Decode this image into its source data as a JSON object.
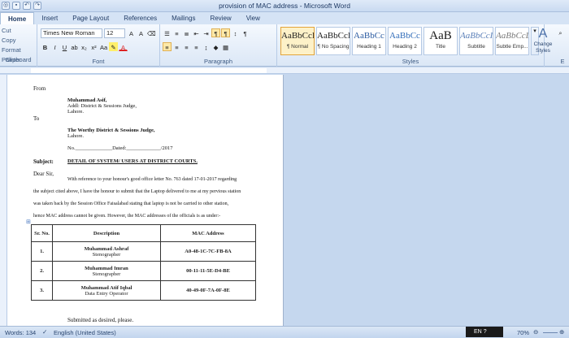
{
  "window": {
    "title": "provision of MAC address - Microsoft Word"
  },
  "tabs": [
    "Home",
    "Insert",
    "Page Layout",
    "References",
    "Mailings",
    "Review",
    "View"
  ],
  "ribbon": {
    "clipboard": {
      "cut": "Cut",
      "copy": "Copy",
      "format_painter": "Format Painter",
      "label": "Clipboard"
    },
    "font": {
      "name": "Times New Roman",
      "size": "12",
      "label": "Font"
    },
    "paragraph": {
      "label": "Paragraph"
    },
    "styles": {
      "label": "Styles",
      "change_styles": "Change Styles",
      "items": [
        {
          "sample": "AaBbCcI",
          "name": "¶ Normal"
        },
        {
          "sample": "AaBbCcI",
          "name": "¶ No Spacing"
        },
        {
          "sample": "AaBbCc",
          "name": "Heading 1"
        },
        {
          "sample": "AaBbCc",
          "name": "Heading 2"
        },
        {
          "sample": "AaB",
          "name": "Title"
        },
        {
          "sample": "AaBbCcI",
          "name": "Subtitle"
        },
        {
          "sample": "AaBbCcL",
          "name": "Subtle Emp..."
        }
      ]
    },
    "editing": {
      "label": "E"
    }
  },
  "document": {
    "from": "From",
    "sender_name": "Muhammad Asif,",
    "sender_title": "Addl: District & Sessions Judge,",
    "sender_city": "Lahore.",
    "to": "To",
    "recipient_name": "The Worthy District & Sessions Judge,",
    "recipient_city": "Lahore.",
    "ref_no": "No.______________Dated:_____________/2017",
    "subject_label": "Subject:",
    "subject_text": "DETAIL OF SYSTEM/ USERS AT DISTRICT COURTS.",
    "salutation": "Dear Sir,",
    "para_line1": "With reference to your honour's good office letter No. 763 dated 17-01-2017 regarding",
    "para_line2": "the subject cited above, I have the honour to submit that the Laptop delivered to me at my pervious station",
    "para_line3": "was taken back by the Session Office Faisalabad stating that laptop is not be carried to other station,",
    "para_line4": "hence MAC address cannot be given. However, the MAC addresses of the officials is as under:-",
    "table": {
      "headers": [
        "Sr. No.",
        "Description",
        "MAC Address"
      ],
      "rows": [
        {
          "sr": "1.",
          "name": "Muhammad Ashraf",
          "role": "Stenographer",
          "mac": "A0-48-1C-7C-FB-8A"
        },
        {
          "sr": "2.",
          "name": "Muhammad Imran",
          "role": "Stenographer",
          "mac": "00-11-11-5E-D4-BE"
        },
        {
          "sr": "3.",
          "name": "Muhammad Atif Iqbal",
          "role": "Data Entry Operator",
          "mac": "40-49-0F-7A-0F-8E"
        }
      ]
    },
    "closing": "Submitted as desired, please."
  },
  "status": {
    "words": "Words: 134",
    "language": "English (United States)",
    "zoom": "70%"
  },
  "taskbar": {
    "lang": "EN"
  }
}
